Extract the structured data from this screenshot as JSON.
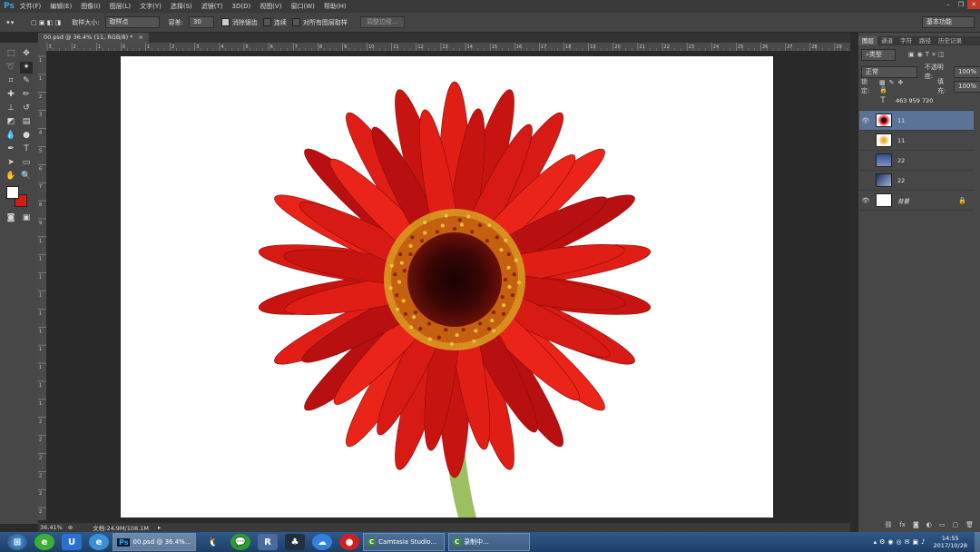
{
  "app": {
    "logo": "Ps"
  },
  "menu": [
    "文件(F)",
    "编辑(E)",
    "图像(I)",
    "图层(L)",
    "文字(Y)",
    "选择(S)",
    "滤镜(T)",
    "3D(D)",
    "视图(V)",
    "窗口(W)",
    "帮助(H)"
  ],
  "window_controls": {
    "minimize": "–",
    "restore": "❐",
    "close": "✕"
  },
  "options": {
    "sample_size_label": "取样大小:",
    "sample_size_value": "取样点",
    "tolerance_label": "容差:",
    "tolerance_value": "30",
    "antialias_label": "消除锯齿",
    "contiguous_label": "连续",
    "all_layers_label": "对所有图层取样",
    "refine_edge_label": "调整边缘...",
    "workspace_value": "基本功能"
  },
  "document_tab": {
    "title": "00.psd @ 36.4% (11, RGB/8) *",
    "close": "×"
  },
  "ruler": {
    "h_ticks": [
      "3",
      "2",
      "1",
      "0",
      "1",
      "2",
      "3",
      "4",
      "5",
      "6",
      "7",
      "8",
      "9",
      "10",
      "11",
      "12",
      "13",
      "14",
      "15",
      "16",
      "17",
      "18",
      "19",
      "20",
      "21",
      "22",
      "23",
      "24",
      "25",
      "26",
      "27",
      "28",
      "29"
    ],
    "v_ticks": [
      "1",
      "1",
      "2",
      "3",
      "4",
      "5",
      "6",
      "7",
      "8",
      "9",
      "1 0",
      "1 1",
      "1 2",
      "1 3",
      "1 4",
      "1 5",
      "1 6",
      "1 7",
      "1 8",
      "1 9",
      "2 0",
      "2 1",
      "2 2",
      "2 3",
      "2 4",
      "2 5"
    ]
  },
  "status": {
    "zoom": "36.41%",
    "doc_info": "文档:24.9M/108.1M"
  },
  "panel": {
    "tabs": [
      "图层",
      "通道",
      "字符",
      "路径",
      "历史记录"
    ],
    "kind_label": "类型",
    "blend_mode": "正常",
    "opacity_label": "不透明度:",
    "opacity_value": "100%",
    "lock_label": "锁定:",
    "fill_label": "填充:",
    "fill_value": "100%",
    "layers": [
      {
        "name": "463 959 720",
        "type": "text",
        "visible": false,
        "active": false
      },
      {
        "name": "11",
        "type": "image",
        "visible": true,
        "active": true,
        "thumb_color": "#c81010"
      },
      {
        "name": "11",
        "type": "image",
        "visible": false,
        "active": false,
        "thumb_color": "#e8d070"
      },
      {
        "name": "22",
        "type": "image",
        "visible": false,
        "active": false,
        "thumb_color": "#4060a0"
      },
      {
        "name": "22",
        "type": "image",
        "visible": false,
        "active": false,
        "thumb_color": "#506080"
      },
      {
        "name": "背景",
        "type": "background",
        "visible": true,
        "active": false,
        "thumb_color": "#ffffff"
      }
    ]
  },
  "taskbar": {
    "tasks": [
      "00.psd @ 36.4%...",
      "Camtasia Studio...",
      "录制中..."
    ],
    "clock_time": "14:55",
    "clock_date": "2017/10/28"
  },
  "colors": {
    "flower_red": "#d61a14",
    "flower_center": "#2a0505",
    "stamen": "#d89a20",
    "stem": "#9cc060",
    "accent_blue": "#5a7396"
  }
}
